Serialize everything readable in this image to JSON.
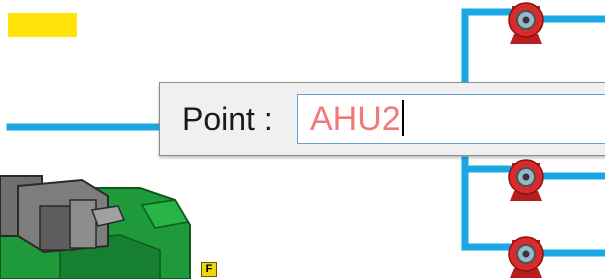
{
  "point_dialog": {
    "label": "Point :",
    "input_value": "AHU2"
  },
  "fan_status_marker": {
    "letter": "F"
  },
  "colors": {
    "duct": "#1aa8e4",
    "fan_housing": "#d92b2b",
    "equipment_green": "#1f9a3a",
    "equipment_gray": "#6f6f6f",
    "yellow_indicator": "#ffe40a",
    "input_text": "#f07a7a"
  },
  "icons": [
    "fan-icon",
    "ahu-equipment-icon",
    "indicator-block"
  ]
}
